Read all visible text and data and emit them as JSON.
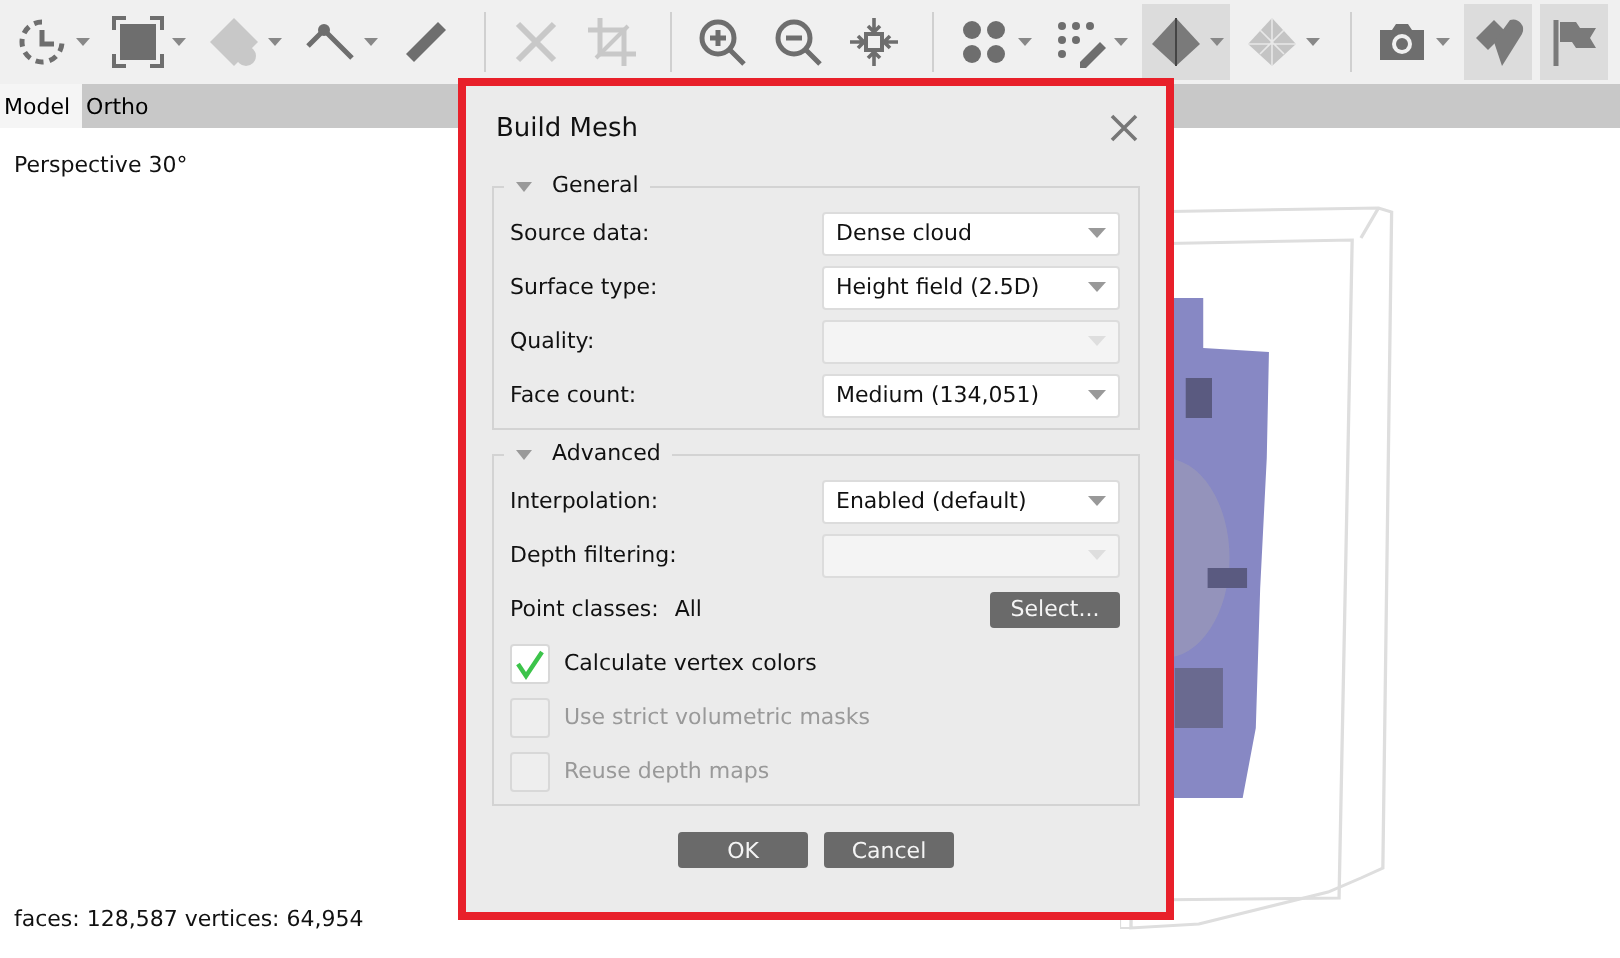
{
  "toolbar": {
    "tools": [
      {
        "kind": "circle-select",
        "has_menu": true,
        "disabled": false,
        "selected": false
      },
      {
        "kind": "rect-select",
        "has_menu": true,
        "disabled": false,
        "selected": false
      },
      {
        "kind": "hand-shape",
        "has_menu": true,
        "disabled": true,
        "selected": false
      },
      {
        "kind": "measure-line",
        "has_menu": true,
        "disabled": false,
        "selected": false
      },
      {
        "kind": "ruler",
        "has_menu": false,
        "disabled": false,
        "selected": false
      },
      {
        "kind": "sep"
      },
      {
        "kind": "delete",
        "has_menu": false,
        "disabled": true,
        "selected": false
      },
      {
        "kind": "crop",
        "has_menu": false,
        "disabled": true,
        "selected": false
      },
      {
        "kind": "sep"
      },
      {
        "kind": "zoom-in",
        "has_menu": false,
        "disabled": false,
        "selected": false
      },
      {
        "kind": "zoom-out",
        "has_menu": false,
        "disabled": false,
        "selected": false
      },
      {
        "kind": "fit",
        "has_menu": false,
        "disabled": false,
        "selected": false
      },
      {
        "kind": "sep"
      },
      {
        "kind": "points",
        "has_menu": true,
        "disabled": false,
        "selected": false
      },
      {
        "kind": "dots-edit",
        "has_menu": true,
        "disabled": false,
        "selected": false
      },
      {
        "kind": "solid",
        "has_menu": true,
        "disabled": false,
        "selected": true
      },
      {
        "kind": "wire",
        "has_menu": true,
        "disabled": false,
        "selected": false
      },
      {
        "kind": "sep"
      },
      {
        "kind": "camera",
        "has_menu": true,
        "disabled": false,
        "selected": false
      },
      {
        "kind": "shapes",
        "has_menu": false,
        "disabled": false,
        "selected": true
      },
      {
        "kind": "flag",
        "has_menu": false,
        "disabled": false,
        "selected": true
      }
    ]
  },
  "tabs": [
    {
      "label": "Model",
      "selected": true
    },
    {
      "label": "Ortho",
      "selected": false
    }
  ],
  "viewport": {
    "projection": "Perspective 30°",
    "status": "faces: 128,587 vertices: 64,954"
  },
  "dialog": {
    "title": "Build Mesh",
    "groups": [
      {
        "title": "General",
        "expanded": true,
        "rows": [
          {
            "kind": "combo",
            "label": "Source data:",
            "value": "Dense cloud",
            "disabled": false
          },
          {
            "kind": "combo",
            "label": "Surface type:",
            "value": "Height field (2.5D)",
            "disabled": false
          },
          {
            "kind": "combo",
            "label": "Quality:",
            "disabled": true
          },
          {
            "kind": "combo",
            "label": "Face count:",
            "value": "Medium (134,051)",
            "disabled": false
          }
        ]
      },
      {
        "title": "Advanced",
        "expanded": true,
        "rows": [
          {
            "kind": "combo",
            "label": "Interpolation:",
            "value": "Enabled (default)",
            "disabled": false
          },
          {
            "kind": "combo",
            "label": "Depth filtering:",
            "disabled": true
          },
          {
            "kind": "select",
            "label": "Point classes:",
            "value": "All",
            "button": "Select..."
          },
          {
            "kind": "checkbox",
            "label": "Calculate vertex colors",
            "checked": true,
            "disabled": false
          },
          {
            "kind": "checkbox",
            "label": "Use strict volumetric masks",
            "checked": false,
            "disabled": true
          },
          {
            "kind": "checkbox",
            "label": "Reuse depth maps",
            "checked": false,
            "disabled": true
          }
        ]
      }
    ],
    "buttons": [
      "OK",
      "Cancel"
    ]
  }
}
